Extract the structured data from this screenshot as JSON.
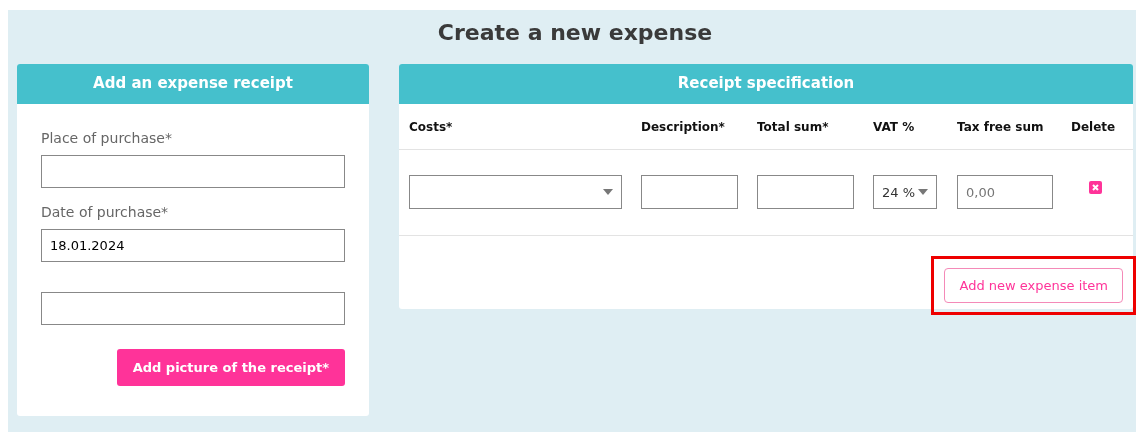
{
  "page": {
    "title": "Create a new expense"
  },
  "receipt_card": {
    "title": "Add an expense receipt",
    "fields": [
      {
        "kind": "text_input",
        "label": "Place of purchase*"
      },
      {
        "kind": "text_input",
        "label": "Date of purchase*",
        "value": "18.01.2024"
      },
      {
        "kind": "text_input"
      }
    ],
    "button": "Add picture of the receipt*"
  },
  "spec_card": {
    "title": "Receipt specification",
    "columns": [
      "Costs*",
      "Description*",
      "Total sum*",
      "VAT %",
      "Tax free sum",
      "Delete"
    ],
    "rows": [
      {
        "vat": "24 %",
        "tax_free_placeholder": "0,00"
      }
    ],
    "add_button": {
      "label": "Add new expense item",
      "highlighted": true
    }
  }
}
